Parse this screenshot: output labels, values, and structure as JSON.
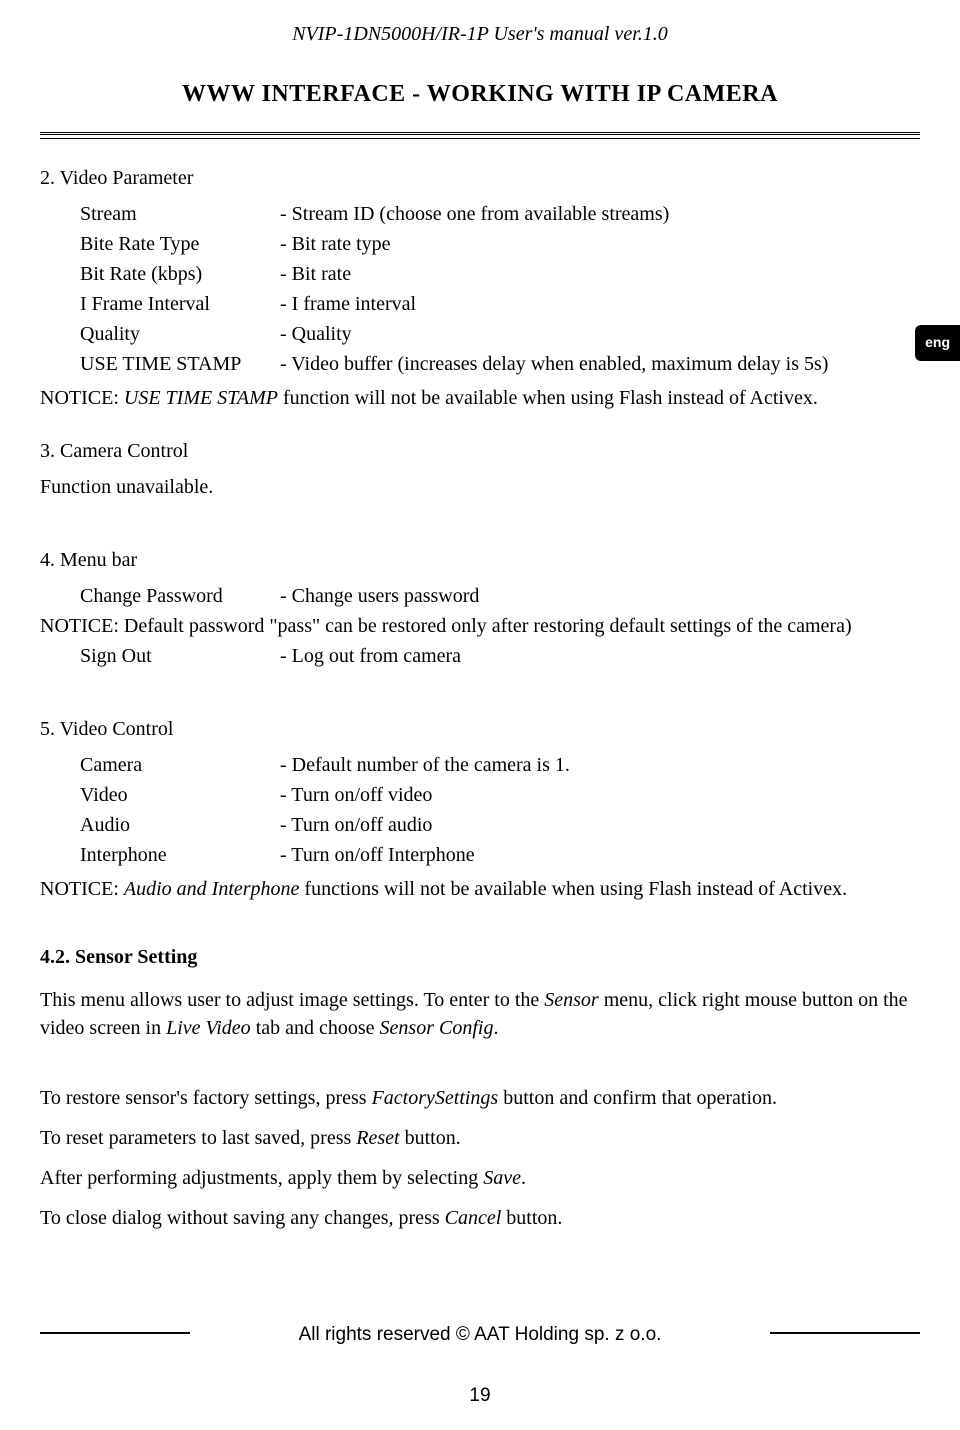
{
  "header": "NVIP-1DN5000H/IR-1P User's manual ver.1.0",
  "title": "WWW INTERFACE - WORKING WITH IP CAMERA",
  "lang_tab": "eng",
  "sec2": {
    "heading": "2. Video Parameter",
    "rows": [
      {
        "label": "Stream",
        "desc": "- Stream ID (choose one from available streams)"
      },
      {
        "label": "Bite Rate Type",
        "desc": "- Bit rate type"
      },
      {
        "label": "Bit Rate (kbps)",
        "desc": "- Bit rate"
      },
      {
        "label": "I Frame Interval",
        "desc": "- I frame interval"
      },
      {
        "label": "Quality",
        "desc": "- Quality"
      },
      {
        "label": "USE TIME STAMP",
        "desc": "- Video buffer (increases delay when enabled, maximum delay is 5s)"
      }
    ],
    "notice_prefix": "NOTICE: ",
    "notice_italic": "USE TIME STAMP",
    "notice_rest": " function will not be available when using Flash instead of Activex."
  },
  "sec3": {
    "heading": "3. Camera Control",
    "body": "Function unavailable."
  },
  "sec4": {
    "heading": "4. Menu bar",
    "row1_label": "Change Password",
    "row1_desc": "- Change users password",
    "notice": "NOTICE: Default password \"pass\" can be restored only after restoring default settings of the camera)",
    "row2_label": "Sign Out",
    "row2_desc": "- Log out from camera"
  },
  "sec5": {
    "heading": "5. Video Control",
    "rows": [
      {
        "label": "Camera",
        "desc": "- Default number of the camera is 1."
      },
      {
        "label": "Video",
        "desc": "- Turn on/off video"
      },
      {
        "label": "Audio",
        "desc": "- Turn on/off audio"
      },
      {
        "label": "Interphone",
        "desc": "- Turn on/off Interphone"
      }
    ],
    "notice_prefix": "NOTICE: ",
    "notice_italic": "Audio and Interphone",
    "notice_rest": " functions will not be available when using Flash instead of Activex."
  },
  "sensor": {
    "heading": "4.2. Sensor Setting",
    "p1_a": "This menu allows user to adjust image settings. To enter to the ",
    "p1_i1": "Sensor",
    "p1_b": " menu, click right mouse button on the video screen in ",
    "p1_i2": "Live Video",
    "p1_c": " tab and choose ",
    "p1_i3": "Sensor Config",
    "p1_d": ".",
    "p2_a": "To restore sensor's factory settings, press ",
    "p2_i": "FactorySettings",
    "p2_b": " button and confirm that operation.",
    "p3_a": "To reset parameters to last saved, press ",
    "p3_i": "Reset",
    "p3_b": " button.",
    "p4_a": "After performing adjustments, apply them by selecting ",
    "p4_i": "Save",
    "p4_b": ".",
    "p5_a": "To close dialog without saving any changes, press ",
    "p5_i": "Cancel",
    "p5_b": " button."
  },
  "footer": "All rights reserved © AAT Holding sp. z o.o.",
  "page_num": "19"
}
